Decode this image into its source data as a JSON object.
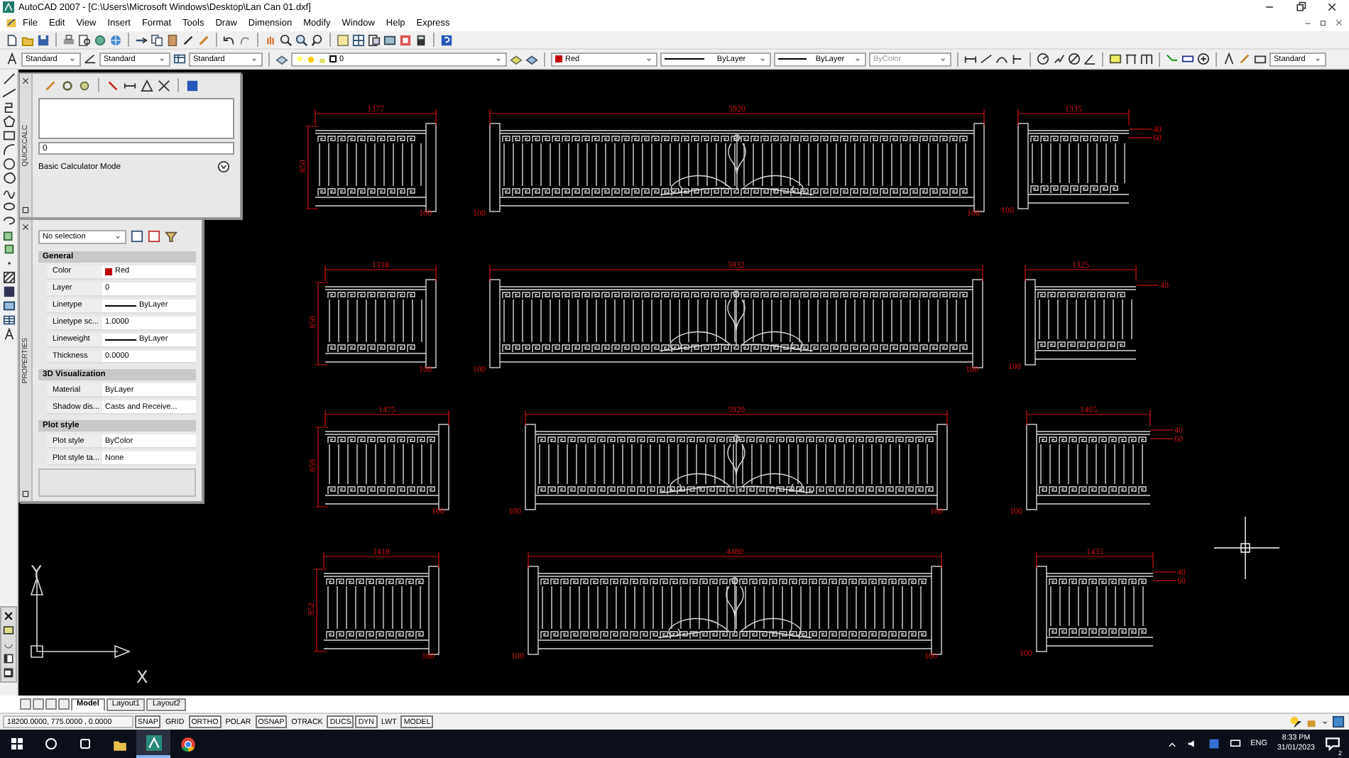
{
  "window": {
    "title": "AutoCAD 2007 - [C:\\Users\\Microsoft Windows\\Desktop\\Lan Can 01.dxf]"
  },
  "menu": [
    "File",
    "Edit",
    "View",
    "Insert",
    "Format",
    "Tools",
    "Draw",
    "Dimension",
    "Modify",
    "Window",
    "Help",
    "Express"
  ],
  "styles_toolbar": {
    "text_style": "Standard",
    "dimension_style": "Standard",
    "table_style": "Standard",
    "layer": "0",
    "color_name": "Red",
    "linetype": "ByLayer",
    "lineweight": "ByLayer",
    "plot_style": "ByColor",
    "multileader_style": "Standard"
  },
  "quickcalc": {
    "title": "QUICKCALC",
    "input": "0",
    "mode": "Basic Calculator Mode"
  },
  "properties": {
    "title": "PROPERTIES",
    "selection": "No selection",
    "sections": [
      {
        "name": "General",
        "rows": [
          {
            "label": "Color",
            "value": "Red",
            "kind": "color",
            "color": "#c00000"
          },
          {
            "label": "Layer",
            "value": "0",
            "kind": "text"
          },
          {
            "label": "Linetype",
            "value": "ByLayer",
            "kind": "line"
          },
          {
            "label": "Linetype sc...",
            "value": "1.0000",
            "kind": "text"
          },
          {
            "label": "Lineweight",
            "value": "ByLayer",
            "kind": "line"
          },
          {
            "label": "Thickness",
            "value": "0.0000",
            "kind": "text"
          }
        ]
      },
      {
        "name": "3D Visualization",
        "rows": [
          {
            "label": "Material",
            "value": "ByLayer",
            "kind": "text"
          },
          {
            "label": "Shadow dis...",
            "value": "Casts and Receive...",
            "kind": "text"
          }
        ]
      },
      {
        "name": "Plot style",
        "rows": [
          {
            "label": "Plot style",
            "value": "ByColor",
            "kind": "text"
          },
          {
            "label": "Plot style ta...",
            "value": "None",
            "kind": "text"
          }
        ]
      }
    ]
  },
  "drawing": {
    "railings": [
      {
        "kind": "left",
        "width_label": "1377",
        "height_label": "850",
        "post_labels": [
          "100"
        ]
      },
      {
        "kind": "center",
        "width_label": "5920",
        "post_labels": [
          "100",
          "100"
        ]
      },
      {
        "kind": "right",
        "width_label": "1335",
        "post_labels": [
          "100"
        ],
        "side_labels": [
          "40",
          "60"
        ]
      },
      {
        "kind": "left",
        "width_label": "1318",
        "height_label": "850",
        "post_labels": [
          "100"
        ]
      },
      {
        "kind": "center",
        "width_label": "5932",
        "post_labels": [
          "100",
          "100"
        ]
      },
      {
        "kind": "right",
        "width_label": "1325",
        "post_labels": [
          "100"
        ],
        "side_labels": [
          "40"
        ]
      },
      {
        "kind": "left",
        "width_label": "1475",
        "height_label": "850",
        "post_labels": [
          "100"
        ]
      },
      {
        "kind": "center",
        "width_label": "5920",
        "post_labels": [
          "100",
          "100"
        ]
      },
      {
        "kind": "right",
        "width_label": "1465",
        "post_labels": [
          "100"
        ],
        "side_labels": [
          "40",
          "60"
        ]
      },
      {
        "kind": "left",
        "width_label": "1418",
        "height_label": "852",
        "post_labels": [
          "100"
        ]
      },
      {
        "kind": "center",
        "width_label": "4480",
        "post_labels": [
          "100",
          "100"
        ]
      },
      {
        "kind": "right",
        "width_label": "1435",
        "post_labels": [
          "100"
        ],
        "side_labels": [
          "40",
          "60"
        ]
      }
    ],
    "ucs": {
      "x_label": "X",
      "y_label": "Y"
    }
  },
  "layout_tabs": [
    {
      "label": "Model",
      "selected": true
    },
    {
      "label": "Layout1",
      "selected": false
    },
    {
      "label": "Layout2",
      "selected": false
    }
  ],
  "status_bar": {
    "coordinates": "18200.0000, 775.0000 , 0.0000",
    "toggles": [
      {
        "label": "SNAP",
        "on": true
      },
      {
        "label": "GRID",
        "on": false
      },
      {
        "label": "ORTHO",
        "on": true
      },
      {
        "label": "POLAR",
        "on": false
      },
      {
        "label": "OSNAP",
        "on": true
      },
      {
        "label": "OTRACK",
        "on": false
      },
      {
        "label": "DUCS",
        "on": true
      },
      {
        "label": "DYN",
        "on": true
      },
      {
        "label": "LWT",
        "on": false
      },
      {
        "label": "MODEL",
        "on": true
      }
    ]
  },
  "taskbar": {
    "language": "ENG",
    "time": "8:33 PM",
    "date": "31/01/2023",
    "notifications": "2"
  }
}
